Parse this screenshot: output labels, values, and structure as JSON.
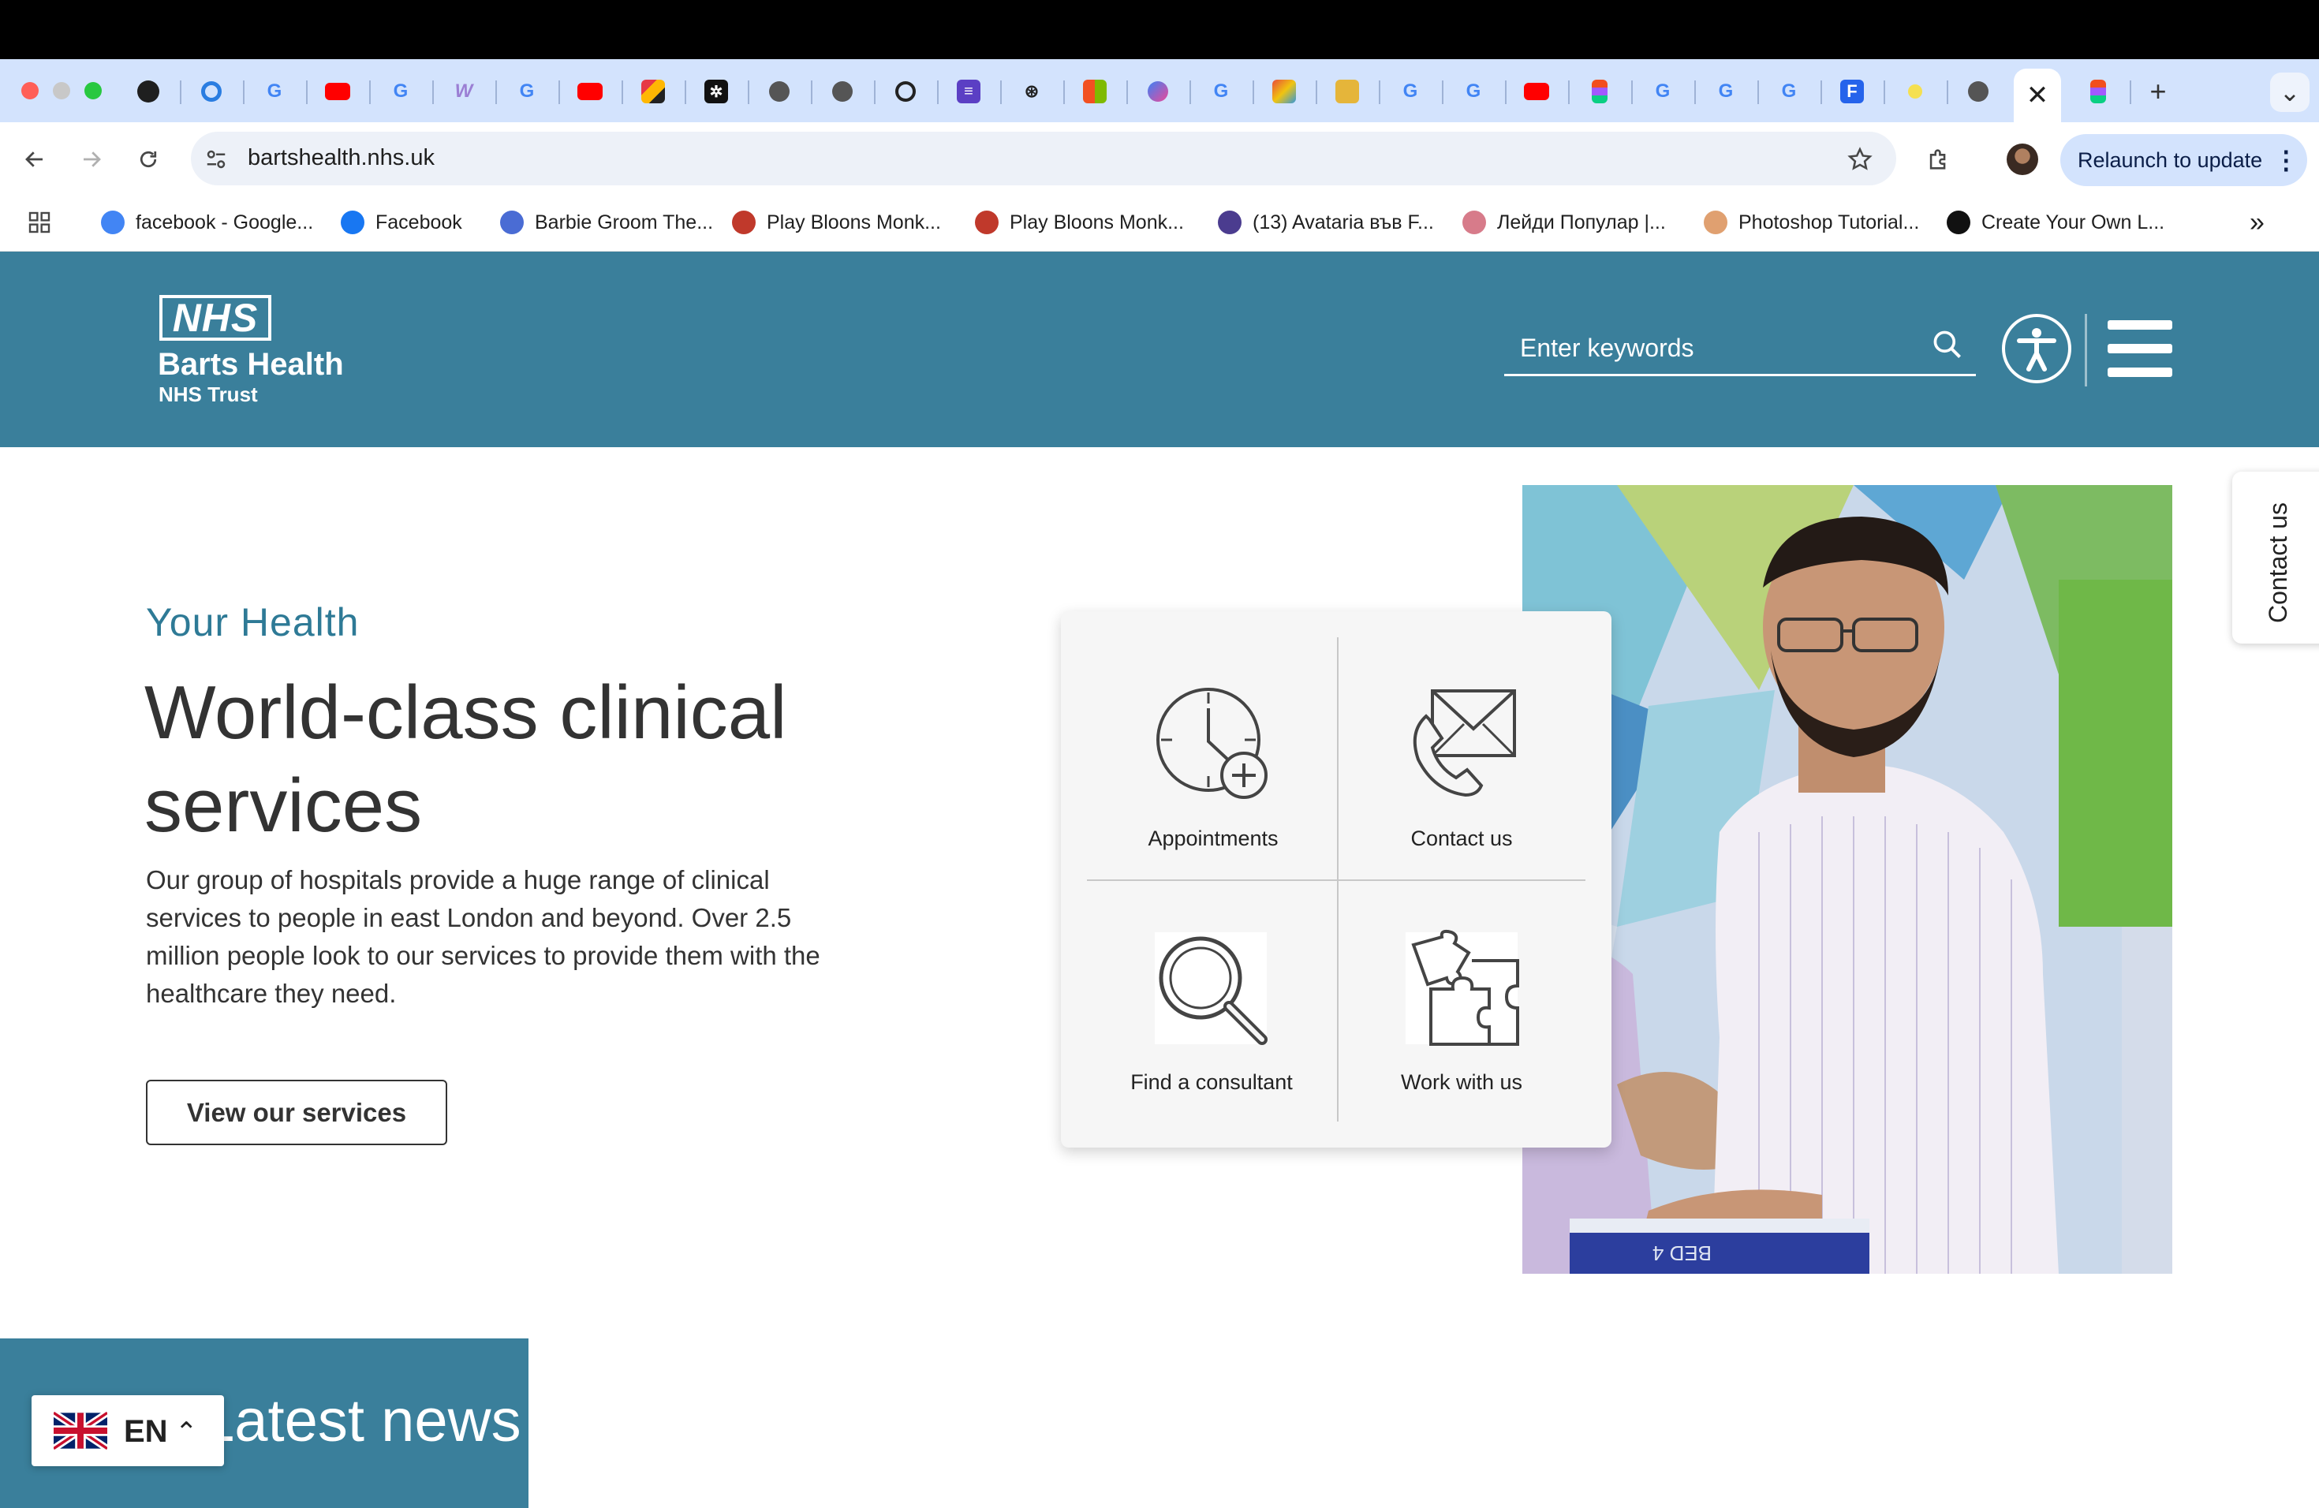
{
  "browser": {
    "active_tab_close": "✕",
    "new_tab": "+",
    "tab_overflow": "⌄",
    "address": "bartshealth.nhs.uk",
    "relaunch_label": "Relaunch to update",
    "relaunch_more": "⋮",
    "bookmarks_overflow": "»",
    "bookmarks": [
      {
        "label": "facebook - Google...",
        "icon": "google-icon",
        "color": "#4285f4"
      },
      {
        "label": "Facebook",
        "icon": "facebook-icon",
        "color": "#1877f2"
      },
      {
        "label": "Barbie Groom The...",
        "icon": "target-icon",
        "color": "#4a6cd4"
      },
      {
        "label": "Play Bloons Monk...",
        "icon": "bloons-icon",
        "color": "#c0392b"
      },
      {
        "label": "Play Bloons Monk...",
        "icon": "bloons-icon",
        "color": "#c0392b"
      },
      {
        "label": "(13) Avataria във F...",
        "icon": "avataria-icon",
        "color": "#4b3c8f"
      },
      {
        "label": "Лейди Популар |...",
        "icon": "lady-popular-icon",
        "color": "#d77b8a"
      },
      {
        "label": "Photoshop Tutorial...",
        "icon": "dash-icon",
        "color": "#e0a070"
      },
      {
        "label": "Create Your Own L...",
        "icon": "create-icon",
        "color": "#111111"
      }
    ]
  },
  "header": {
    "logo_nhs": "NHS",
    "logo_org": "Barts Health",
    "logo_trust": "NHS Trust",
    "search_placeholder": "Enter keywords"
  },
  "hero": {
    "eyebrow": "Your Health",
    "title": "World-class clinical services",
    "body": "Our group of hospitals provide a huge range of clinical services to people in east London and beyond. Over 2.5 million people look to our services to provide them with the healthcare they need.",
    "button": "View our services"
  },
  "quick_links": [
    {
      "label": "Appointments",
      "icon": "clock-plus-icon"
    },
    {
      "label": "Contact us",
      "icon": "phone-envelope-icon"
    },
    {
      "label": "Find a consultant",
      "icon": "magnifier-icon"
    },
    {
      "label": "Work with us",
      "icon": "puzzle-icon"
    }
  ],
  "photo": {
    "bed_label": "BED 4"
  },
  "contact_tab": "Contact us",
  "news": {
    "title": "Latest news"
  },
  "language": {
    "code": "EN",
    "chevron": "⌃"
  },
  "colors": {
    "brand": "#3a7f9b",
    "eyebrow": "#2e7a96",
    "text": "#333333"
  }
}
